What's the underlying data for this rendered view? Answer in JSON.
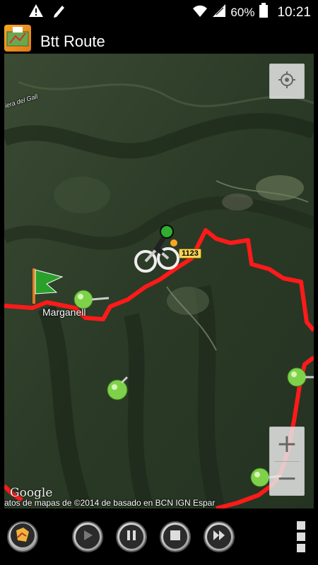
{
  "status_bar": {
    "battery_percent": "60%",
    "time": "10:21",
    "icons": [
      "warning-icon",
      "pencil-icon",
      "wifi-icon",
      "signal-icon",
      "battery-icon"
    ]
  },
  "action_bar": {
    "title": "Btt Route",
    "app_icon": "gps-app-icon"
  },
  "map": {
    "labels": {
      "town": "Marganell",
      "road": "1123",
      "place": "iera del Gall"
    },
    "logo": "Google",
    "attribution": "atos de mapas de ©2014 de basado en BCN IGN Espar",
    "controls": {
      "my_location": "my-location-icon",
      "zoom_in": "+",
      "zoom_out": "−"
    },
    "markers": [
      "start-flag-icon",
      "cyclist-icon",
      "pushpin-icon",
      "pushpin-icon",
      "pushpin-icon",
      "pushpin-icon"
    ],
    "colors": {
      "route": "#ff1a1a",
      "terrain": "#2f3e2a",
      "pin": "#7fd14a"
    }
  },
  "bottom_bar": {
    "buttons": [
      "route-map-icon",
      "play-icon",
      "pause-icon",
      "stop-icon",
      "fast-forward-icon",
      "overflow-menu-icon"
    ]
  }
}
